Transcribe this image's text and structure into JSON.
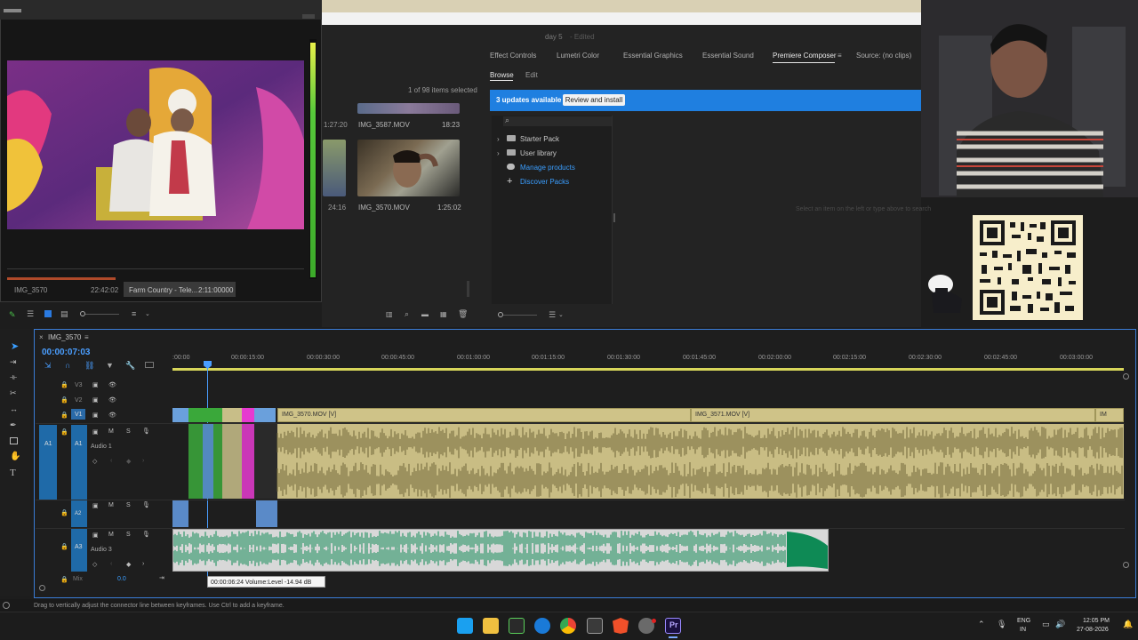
{
  "colors": {
    "accent_blue": "#1f7fe0",
    "timecode_blue": "#4a9eff",
    "clip_video": "#cfc388",
    "audio_wave": "#c9b86a",
    "audio3_wave": "#0e8a55",
    "work_area": "#d7d55a"
  },
  "project": {
    "title": "day 5",
    "state": "- Edited",
    "selection_info": "1 of 98 items selected",
    "items": [
      {
        "name": "IMG_3587.MOV",
        "duration": "18:23",
        "time_left": "1:27:20"
      },
      {
        "name": "IMG_3570.MOV",
        "duration": "1:25:02",
        "time_left": "24:16"
      }
    ]
  },
  "monitor": {
    "clip_name": "IMG_3570",
    "clip_time": "22:42:02",
    "second_clip": "Farm Country - Tele...",
    "second_clip_time": "2:11:00000"
  },
  "tabs": [
    "Effect Controls",
    "Lumetri Color",
    "Essential Graphics",
    "Essential Sound",
    "Premiere Composer",
    "Source: (no clips)"
  ],
  "active_tab": "Premiere Composer",
  "composer": {
    "subtabs": [
      "Browse",
      "Edit"
    ],
    "update_text": "3 updates available",
    "review_button": "Review and install",
    "tree": [
      "Starter Pack",
      "User library",
      "Manage products",
      "Discover Packs"
    ],
    "empty_hint": "Select an item on the left or type above to search"
  },
  "timeline": {
    "sequence": "IMG_3570",
    "timecode": "00:00:07:03",
    "ruler": [
      ":00:00",
      "00:00:15:00",
      "00:00:30:00",
      "00:00:45:00",
      "00:01:00:00",
      "00:01:15:00",
      "00:01:30:00",
      "00:01:45:00",
      "00:02:00:00",
      "00:02:15:00",
      "00:02:30:00",
      "00:02:45:00",
      "00:03:00:00"
    ],
    "video_tracks": [
      "V3",
      "V2",
      "V1"
    ],
    "audio_tracks": [
      {
        "id": "A1",
        "name": "Audio 1"
      },
      {
        "id": "A2",
        "name": ""
      },
      {
        "id": "A3",
        "name": "Audio 3"
      }
    ],
    "mix_label": "Mix",
    "mix_value": "0.0",
    "clips": [
      "IMG_3570.MOV [V]",
      "IMG_3571.MOV [V]",
      "IM"
    ],
    "tooltip": "00:00:06:24  Volume:Level  -14.94 dB",
    "track_header_letters": {
      "m": "M",
      "s": "S"
    }
  },
  "status_text": "Drag to vertically adjust the connector line between keyframes. Use Ctrl to add a keyframe.",
  "taskbar": {
    "lang_line1": "ENG",
    "lang_line2": "IN",
    "time": "12:05 PM",
    "date": "27-08-2026"
  }
}
